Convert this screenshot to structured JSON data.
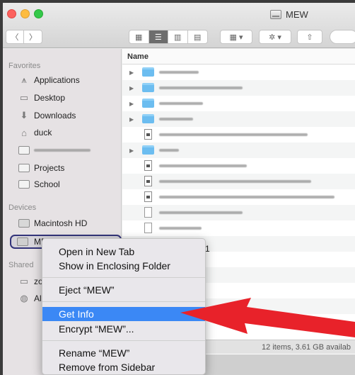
{
  "window": {
    "title": "MEW"
  },
  "toolbar": {
    "back_icon": "chevron-left-icon",
    "forward_icon": "chevron-right-icon",
    "back_glyph": "〈",
    "forward_glyph": "〉",
    "view_glyphs": [
      "▦",
      "☰",
      "▥",
      "▤"
    ],
    "arrange_glyph": "▦ ▾",
    "action_glyph": "✲ ▾",
    "share_glyph": "⇧"
  },
  "sidebar": {
    "favorites_heading": "Favorites",
    "favorites": [
      {
        "label": "Applications",
        "icon": "applications-icon",
        "glyph": "⩚"
      },
      {
        "label": "Desktop",
        "icon": "desktop-icon",
        "glyph": "▭"
      },
      {
        "label": "Downloads",
        "icon": "downloads-icon",
        "glyph": "⬇"
      },
      {
        "label": "duck",
        "icon": "home-icon",
        "glyph": "⌂"
      },
      {
        "label": "",
        "icon": "folder-icon",
        "glyph": ""
      },
      {
        "label": "Projects",
        "icon": "folder-icon",
        "glyph": ""
      },
      {
        "label": "School",
        "icon": "folder-icon",
        "glyph": ""
      }
    ],
    "devices_heading": "Devices",
    "devices": [
      {
        "label": "Macintosh HD",
        "icon": "hard-drive-icon"
      },
      {
        "label": "MEW",
        "icon": "external-drive-icon"
      }
    ],
    "eject_glyph": "▲",
    "shared_heading": "Shared",
    "shared": [
      {
        "label": "zo",
        "icon": "computer-icon",
        "glyph": "▭"
      },
      {
        "label": "Al",
        "icon": "network-icon",
        "glyph": "◍"
      }
    ]
  },
  "content": {
    "column_name": "Name",
    "stray_text": "1",
    "status": "12 items, 3.61 GB availab"
  },
  "context_menu": {
    "items": [
      {
        "label": "Open in New Tab",
        "selected": false
      },
      {
        "label": "Show in Enclosing Folder",
        "selected": false
      },
      {
        "label": "Eject “MEW”",
        "selected": false
      },
      {
        "label": "Get Info",
        "selected": true
      },
      {
        "label": "Encrypt “MEW”...",
        "selected": false
      },
      {
        "label": "Rename “MEW”",
        "selected": false
      },
      {
        "label": "Remove from Sidebar",
        "selected": false
      }
    ]
  },
  "colors": {
    "selection": "#3b88f5",
    "arrow": "#e8222a",
    "highlight_outline": "#33347a"
  }
}
